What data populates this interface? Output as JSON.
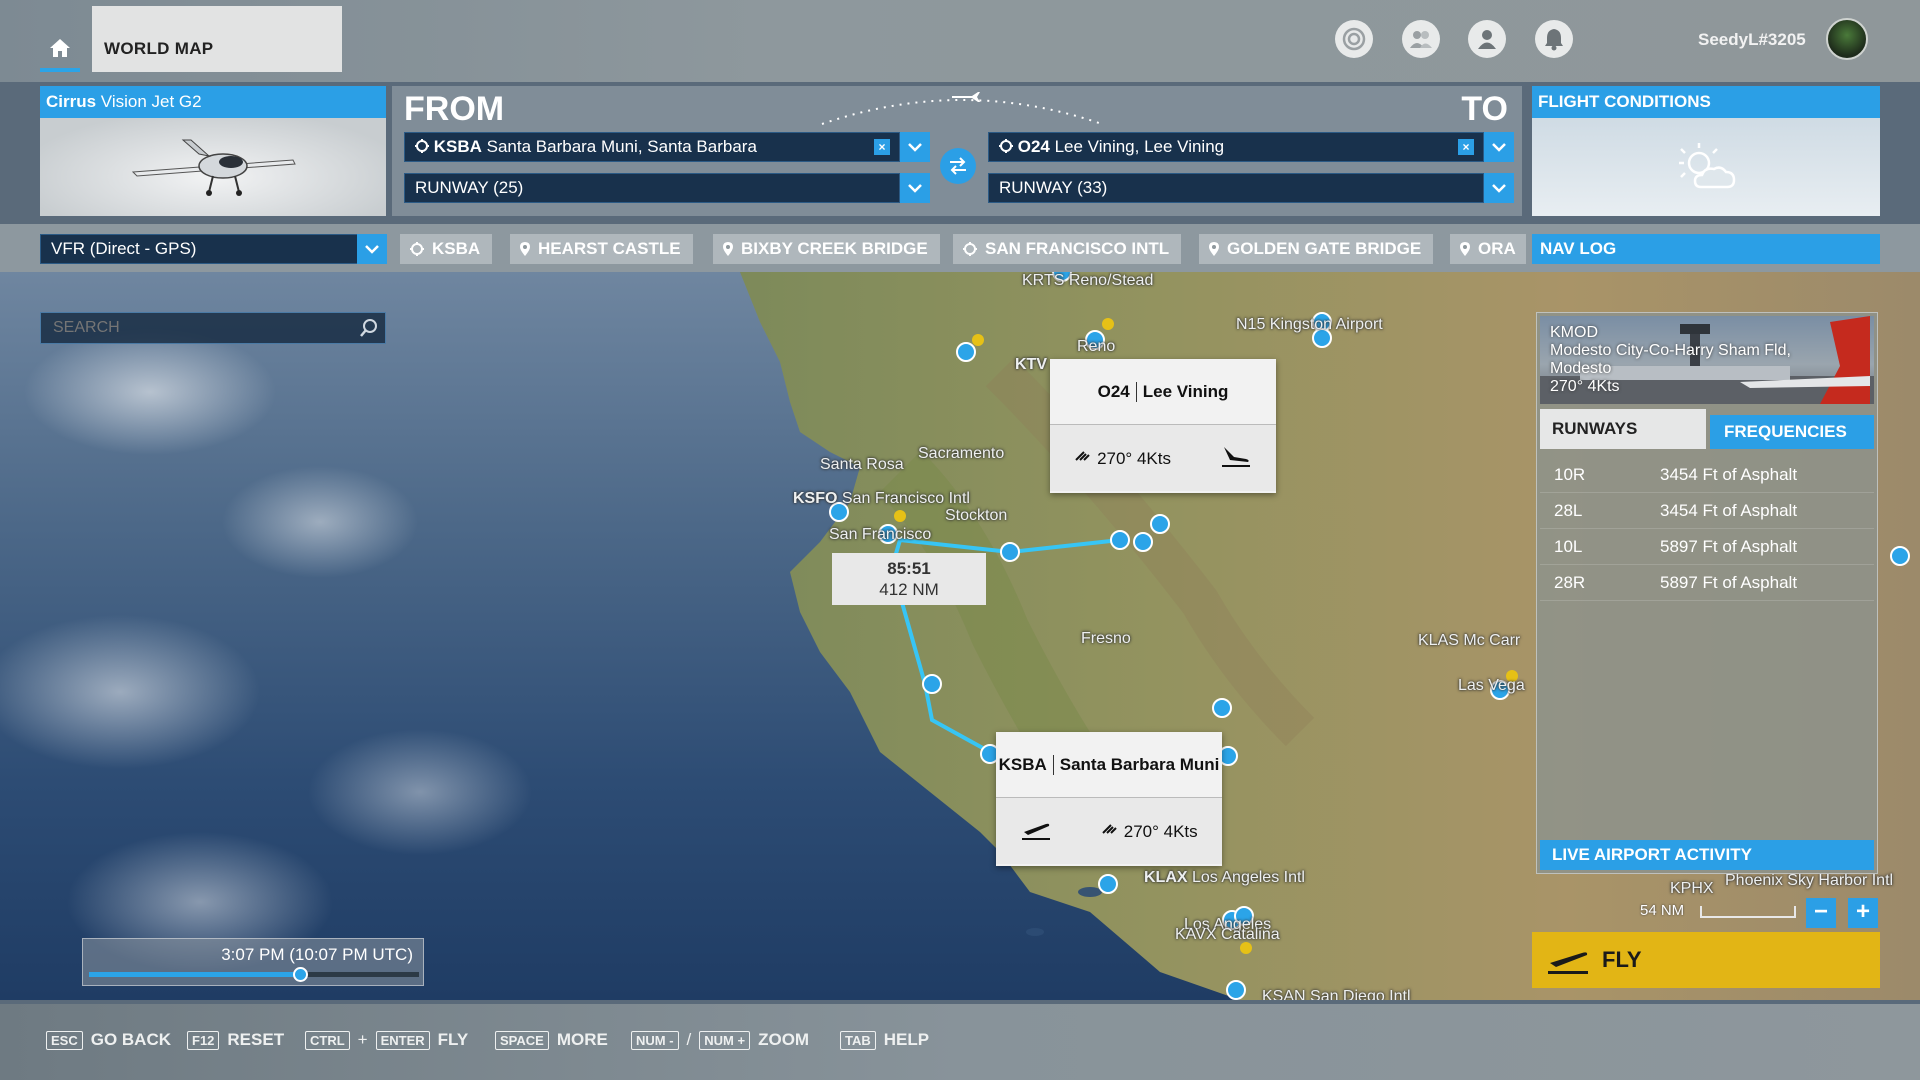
{
  "topbar": {
    "tab": "WORLD MAP",
    "icons": [
      "progress-icon",
      "friends-icon",
      "profile-icon",
      "notification-icon"
    ],
    "username": "SeedyL#3205"
  },
  "aircraft": {
    "name_brand": "Cirrus",
    "name_model": " Vision Jet G2"
  },
  "from": {
    "label": "FROM",
    "airport_code": "KSBA",
    "airport_name": " Santa Barbara Muni, Santa Barbara",
    "runway": "RUNWAY (25)"
  },
  "to": {
    "label": "TO",
    "airport_code": "O24",
    "airport_name": " Lee Vining, Lee Vining",
    "runway": "RUNWAY (33)"
  },
  "conditions": {
    "title": "FLIGHT CONDITIONS"
  },
  "waypoints": {
    "plan_type": "VFR (Direct - GPS)",
    "items": [
      "KSBA",
      "HEARST CASTLE",
      "BIXBY CREEK BRIDGE",
      "SAN FRANCISCO INTL",
      "GOLDEN GATE BRIDGE",
      "ORA"
    ],
    "nav_log": "NAV LOG"
  },
  "search": {
    "placeholder": "SEARCH"
  },
  "map": {
    "labels": {
      "reno_stead": "KRTS Reno/Stead",
      "kingston": "N15 Kingston Airport",
      "reno": "Reno",
      "ktv": "KTV",
      "santa_rosa": "Santa Rosa",
      "sacramento": "Sacramento",
      "ksfo_code": "KSFO",
      "ksfo_name": " San Francisco Intl",
      "stockton": "Stockton",
      "san_francisco": "San Francisco",
      "fresno": "Fresno",
      "klas": "KLAS Mc Carr",
      "las_vegas": "Las Vega",
      "klax_code": "KLAX",
      "klax_name": " Los Angeles Intl",
      "los_angeles": "Los Angeles",
      "kavx": "KAVX Catalina",
      "ksan": "KSAN San Diego Intl",
      "kphx_code": "KPHX",
      "kphx_name": "Phoenix Sky Harbor Intl"
    },
    "dest_card": {
      "code": "O24",
      "name": "Lee Vining",
      "wind": "270° 4Kts"
    },
    "origin_card": {
      "code": "KSBA",
      "name": "Santa Barbara Muni",
      "wind": "270° 4Kts"
    },
    "leg": {
      "time": "85:51",
      "distance": "412 NM"
    }
  },
  "time": {
    "label": "3:07 PM (10:07 PM UTC)",
    "position": 0.64
  },
  "airport_info": {
    "code": "KMOD",
    "name": "Modesto City-Co-Harry Sham Fld,",
    "city": "Modesto",
    "wind": "270° 4Kts",
    "tabs": {
      "runways": "RUNWAYS",
      "frequencies": "FREQUENCIES"
    },
    "runways": [
      {
        "id": "10R",
        "desc": "3454 Ft of Asphalt"
      },
      {
        "id": "28L",
        "desc": "3454 Ft of Asphalt"
      },
      {
        "id": "10L",
        "desc": "5897 Ft of Asphalt"
      },
      {
        "id": "28R",
        "desc": "5897 Ft of Asphalt"
      }
    ],
    "live_activity": "LIVE AIRPORT ACTIVITY"
  },
  "scale": {
    "label": "54 NM",
    "zoom_out": "−",
    "zoom_in": "+"
  },
  "fly_button": {
    "label": "FLY"
  },
  "hints": [
    {
      "keys": [
        "ESC"
      ],
      "label": "GO BACK"
    },
    {
      "keys": [
        "F12"
      ],
      "label": "RESET"
    },
    {
      "keys": [
        "CTRL",
        "ENTER"
      ],
      "joiner": "+",
      "label": "FLY"
    },
    {
      "keys": [
        "SPACE"
      ],
      "label": "MORE"
    },
    {
      "keys": [
        "NUM -",
        "NUM +"
      ],
      "joiner": "/",
      "label": "ZOOM"
    },
    {
      "keys": [
        "TAB"
      ],
      "label": "HELP"
    }
  ],
  "colors": {
    "accent": "#2b9fe6",
    "fly": "#e2b515",
    "field_bg": "#18314c"
  }
}
